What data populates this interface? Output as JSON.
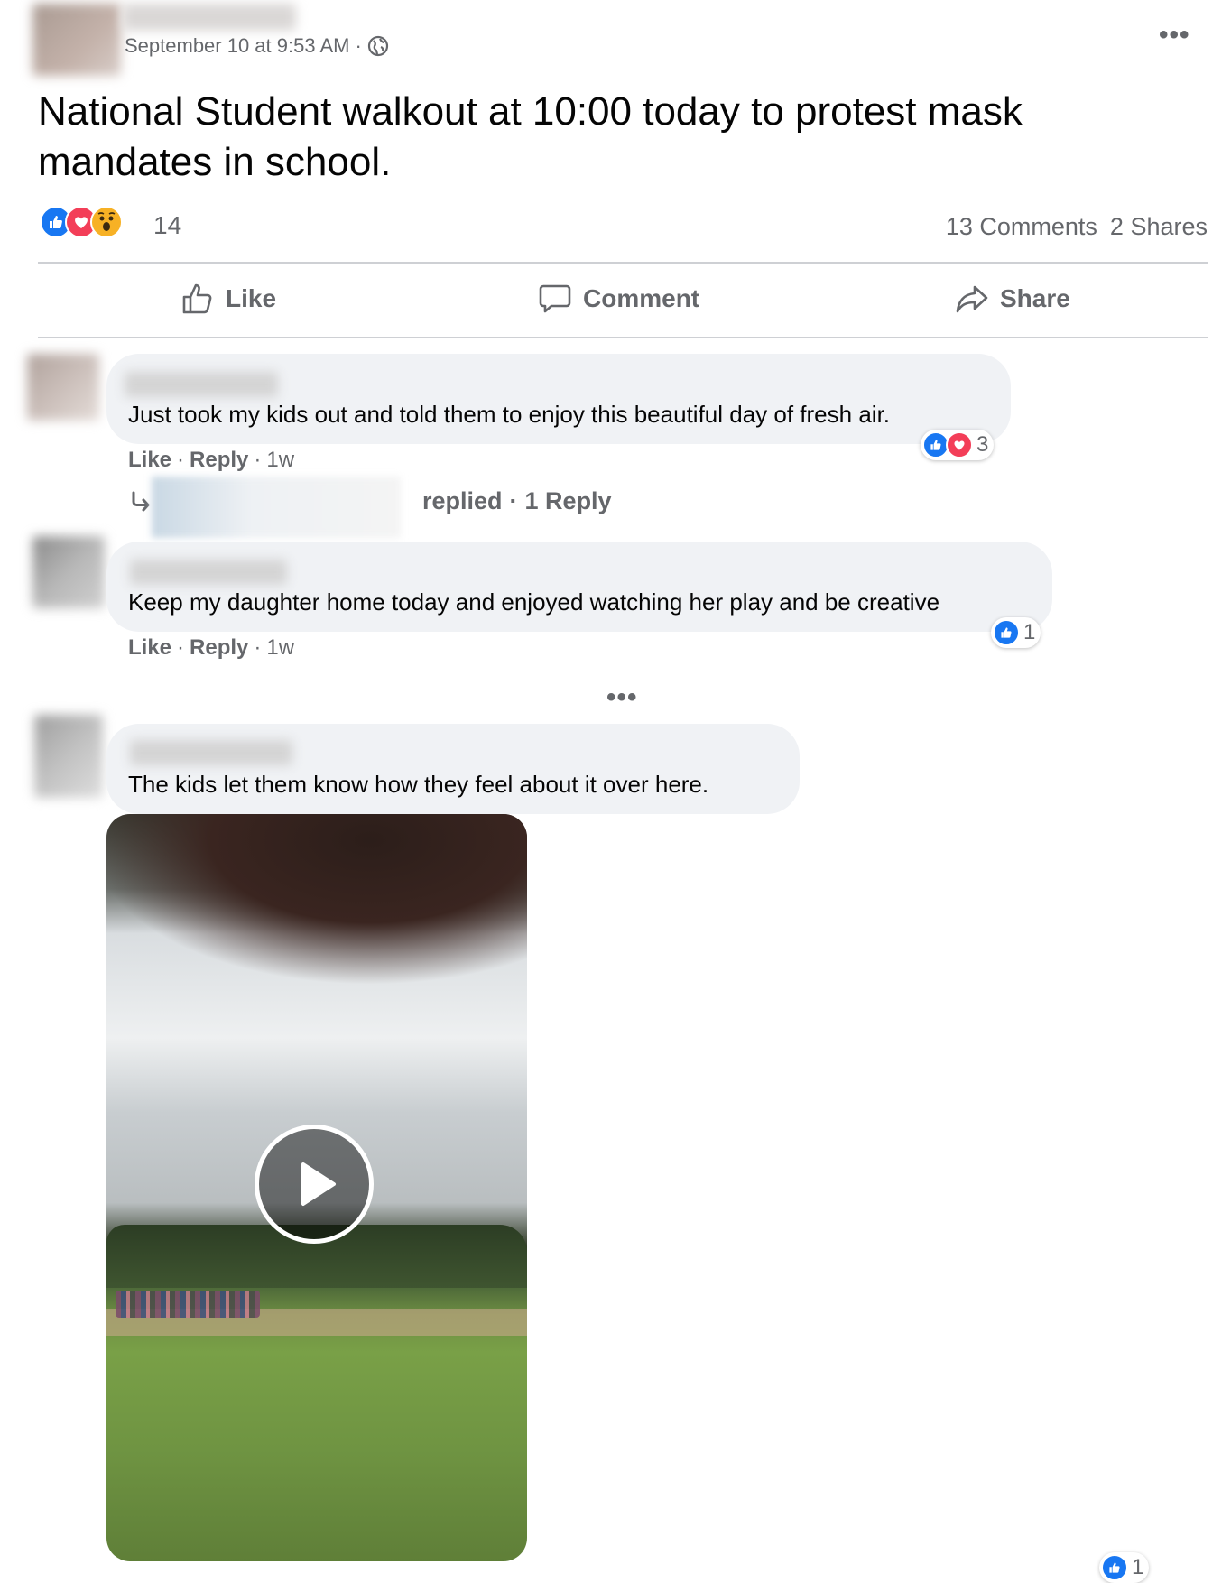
{
  "post": {
    "timestamp": "September 10 at 9:53 AM",
    "separator": "·",
    "text": "National Student walkout at 10:00 today to protest mask mandates in school.",
    "reaction_count": "14",
    "comments_count": "13 Comments",
    "shares_count": "2 Shares",
    "reaction_icons": [
      "like-icon",
      "love-icon",
      "wow-icon"
    ]
  },
  "actions": {
    "like": "Like",
    "comment": "Comment",
    "share": "Share"
  },
  "comments": [
    {
      "text": "Just took my kids out and told them to enjoy this beautiful day of fresh air.",
      "like": "Like",
      "reply": "Reply",
      "age": "1w",
      "reaction_count": "3",
      "replies_text": "replied",
      "replies_count": "1 Reply"
    },
    {
      "text": "Keep my daughter home today and enjoyed watching her play and be creative",
      "like": "Like",
      "reply": "Reply",
      "age": "1w",
      "reaction_count": "1"
    },
    {
      "text": "The kids let them know how they feel about it over here."
    }
  ],
  "bottom_reaction_count": "1",
  "colors": {
    "facebook_blue": "#1877f2",
    "love_red": "#f33e58",
    "wow_yellow": "#f7b125",
    "secondary_text": "#65676b",
    "bubble_bg": "#f0f2f5"
  }
}
